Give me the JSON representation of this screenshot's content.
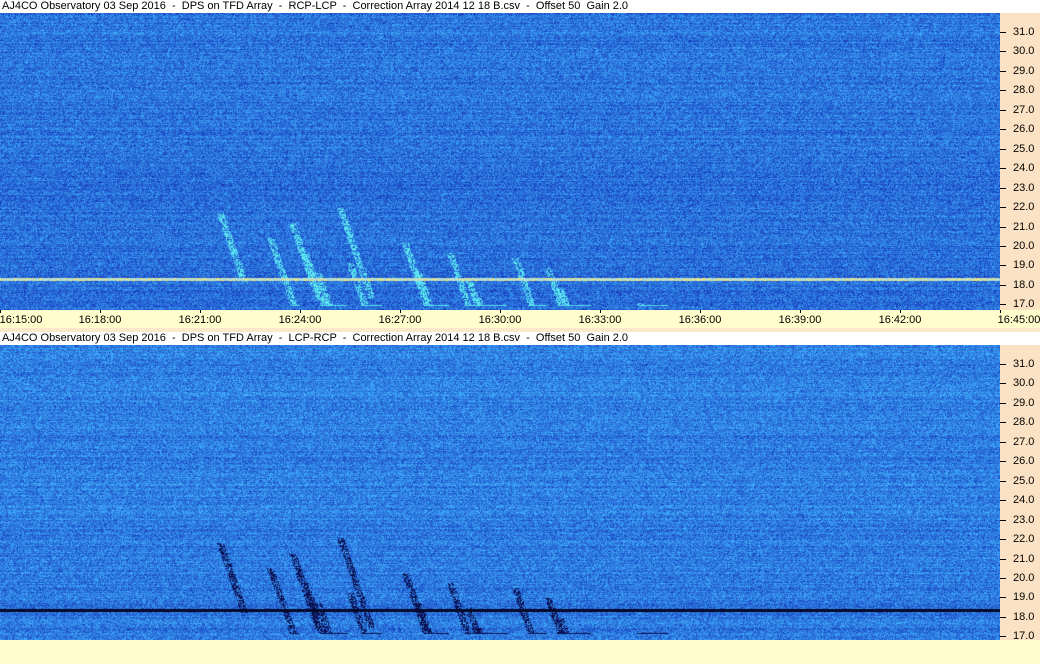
{
  "panels": [
    {
      "title": "AJ4CO Observatory 03 Sep 2016  -  DPS on TFD Array  -  RCP-LCP  -  Correction Array 2014 12 18 B.csv  -  Offset 50  Gain 2.0",
      "mode": "bright"
    },
    {
      "title": "AJ4CO Observatory 03 Sep 2016  -  DPS on TFD Array  -  LCP-RCP  -  Correction Array 2014 12 18 B.csv  -  Offset 50  Gain 2.0",
      "mode": "dark"
    }
  ],
  "freq_labels": [
    "31.0",
    "30.0",
    "29.0",
    "28.0",
    "27.0",
    "26.0",
    "25.0",
    "24.0",
    "23.0",
    "22.0",
    "21.0",
    "20.0",
    "19.0",
    "18.0",
    "17.0"
  ],
  "time_labels": [
    "16:15:00",
    "16:18:00",
    "16:21:00",
    "16:24:00",
    "16:27:00",
    "16:30:00",
    "16:33:00",
    "16:36:00",
    "16:39:00",
    "16:42:00",
    "16:45:00"
  ],
  "colors": {
    "base": "#2458d8",
    "bright": "#38c8f0",
    "dark": "#0a1060",
    "axis_bg": "#fbe2c4",
    "time_bg": "#fffecc"
  }
}
